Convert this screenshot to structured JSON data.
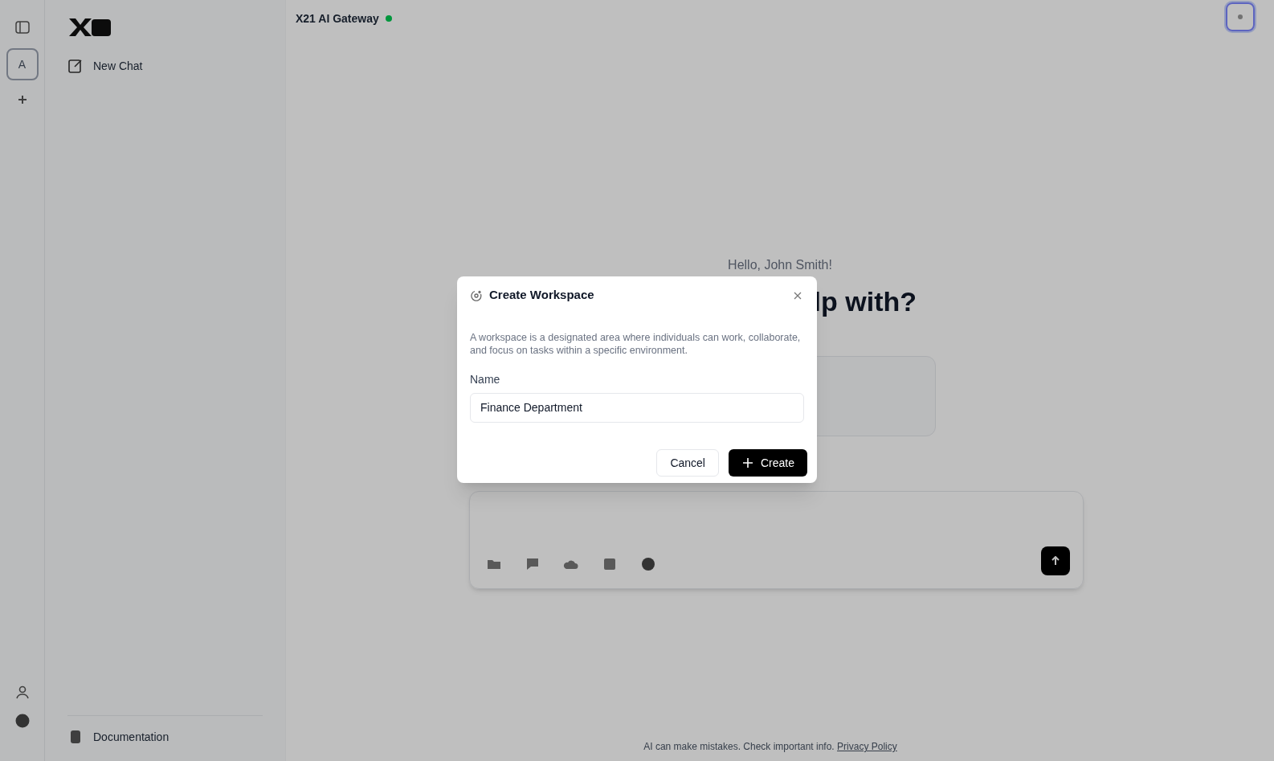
{
  "rail": {
    "workspaces": [
      {
        "initial": "A",
        "selected": true
      }
    ]
  },
  "sidebar": {
    "new_chat": "New Chat",
    "footer_link": "Documentation"
  },
  "header": {
    "title": "X21 AI Gateway",
    "online": true
  },
  "main": {
    "greeting": "Hello, John Smith!",
    "heading_visible": "lp with?"
  },
  "footer": {
    "disclaimer": "AI can make mistakes. Check important info.",
    "privacy_link": "Privacy Policy"
  },
  "dialog": {
    "title": "Create Workspace",
    "description": "A workspace is a designated area where individuals can work, collaborate, and focus on tasks within a specific environment.",
    "field": {
      "label": "Name",
      "value": "Finance Department"
    },
    "buttons": [
      {
        "label": "Cancel",
        "kind": "secondary"
      },
      {
        "label": "Create",
        "kind": "primary"
      }
    ]
  }
}
